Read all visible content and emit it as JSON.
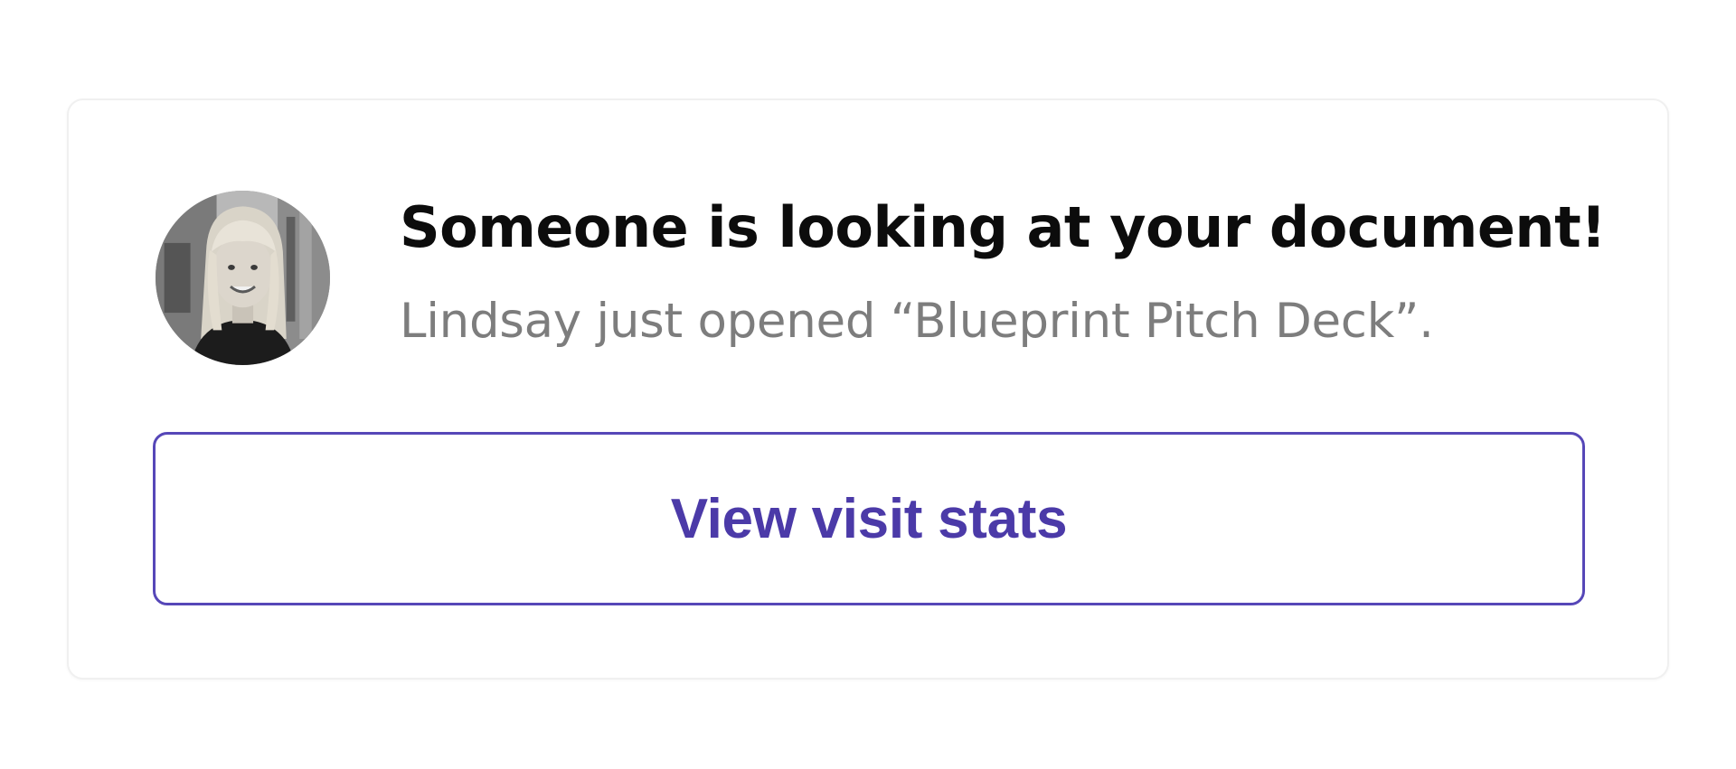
{
  "notification": {
    "title": "Someone is looking at your document!",
    "message": "Lindsay just opened “Blueprint Pitch Deck”.",
    "button_label": "View visit stats",
    "avatar_icon": "user-photo-avatar",
    "accent_color": "#5647b8"
  }
}
